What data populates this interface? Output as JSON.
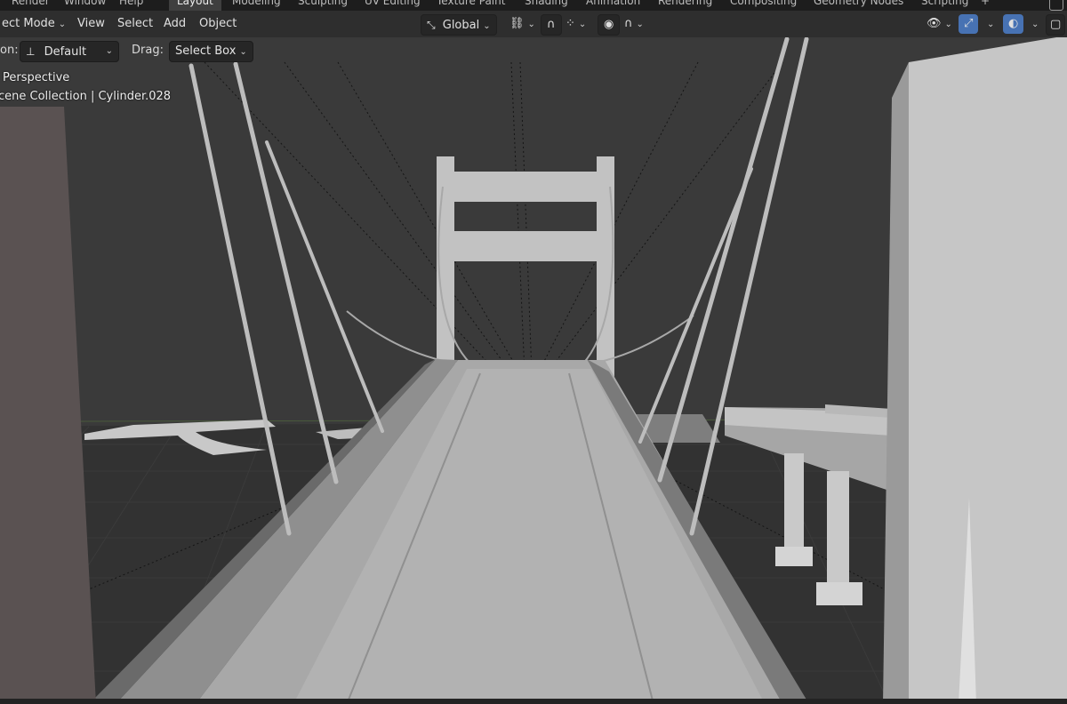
{
  "top_menu": {
    "items": [
      "Render",
      "Window",
      "Help"
    ]
  },
  "workspaces": {
    "tabs": [
      "Layout",
      "Modeling",
      "Sculpting",
      "UV Editing",
      "Texture Paint",
      "Shading",
      "Animation",
      "Rendering",
      "Compositing",
      "Geometry Nodes",
      "Scripting"
    ],
    "active": "Layout",
    "add_label": "+"
  },
  "header": {
    "mode_label": "ect Mode",
    "view_label": "View",
    "select_label": "Select",
    "add_label": "Add",
    "object_label": "Object",
    "orientation_label": "Global"
  },
  "tool_settings": {
    "orientation_prefix": "on:",
    "orientation_value": "Default",
    "drag_label": "Drag:",
    "drag_value": "Select Box"
  },
  "viewport": {
    "view_name": "Perspective",
    "collection_info": "cene Collection | Cylinder.028"
  },
  "colors": {
    "background": "#3a3a3a",
    "header": "#2e2e2e",
    "accent": "#4772b3",
    "mesh": "#b4b4b4"
  }
}
